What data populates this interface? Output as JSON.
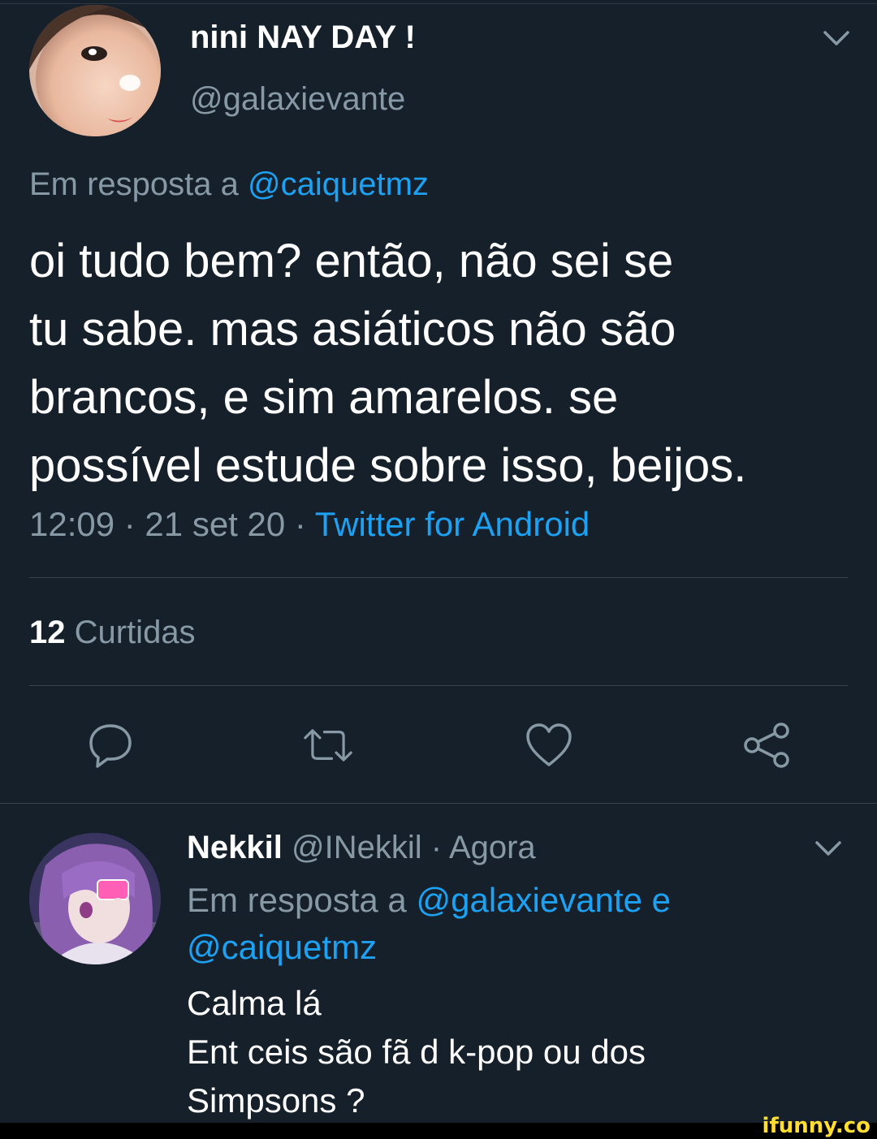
{
  "tweet": {
    "display_name": "nini NAY DAY !",
    "handle": "@galaxievante",
    "reply_to_prefix": "Em resposta a ",
    "reply_to_mention": "@caiquetmz",
    "text_lines": [
      "oi tudo bem? então, não sei se",
      "tu sabe. mas asiáticos não são",
      "brancos, e sim amarelos. se",
      "possível estude sobre isso, beijos."
    ],
    "time_date": "12:09 · 21 set 20 · ",
    "source": "Twitter for Android",
    "likes_count": "12",
    "likes_label": " Curtidas"
  },
  "actions": {
    "reply_icon": "reply-icon",
    "retweet_icon": "retweet-icon",
    "like_icon": "heart-icon",
    "share_icon": "share-icon"
  },
  "reply": {
    "display_name": "Nekkil",
    "handle_time": " @INekkil · Agora",
    "reply_to_prefix": "Em resposta a ",
    "reply_to_mention_1": "@galaxievante e",
    "reply_to_mention_2": "@caiquetmz",
    "text_lines": [
      "Calma lá",
      "Ent ceis são fã d k-pop ou dos",
      "Simpsons ?"
    ]
  },
  "watermark": "ifunny.co",
  "colors": {
    "background": "#15202b",
    "accent": "#1da1f2",
    "secondary_text": "#8899a6",
    "divider": "#38444d"
  }
}
